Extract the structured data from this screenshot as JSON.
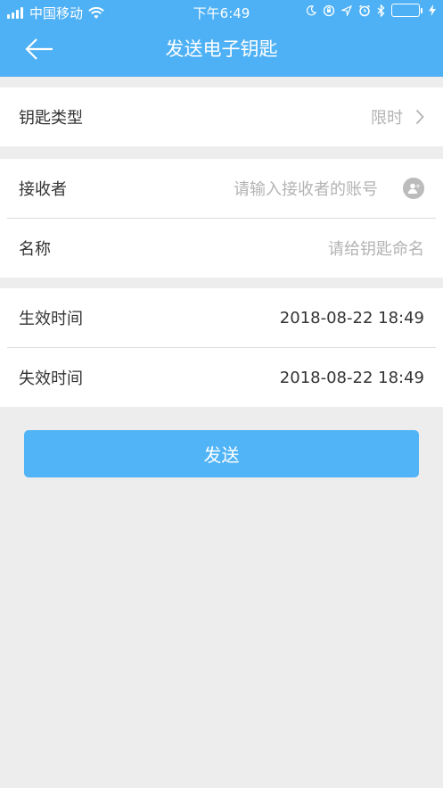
{
  "status_bar": {
    "carrier": "中国移动",
    "time": "下午6:49"
  },
  "nav": {
    "title": "发送电子钥匙"
  },
  "key_type": {
    "label": "钥匙类型",
    "value": "限时"
  },
  "receiver": {
    "label": "接收者",
    "placeholder": "请输入接收者的账号"
  },
  "name": {
    "label": "名称",
    "placeholder": "请给钥匙命名"
  },
  "start_time": {
    "label": "生效时间",
    "value": "2018-08-22 18:49"
  },
  "end_time": {
    "label": "失效时间",
    "value": "2018-08-22 18:49"
  },
  "actions": {
    "send_label": "发送"
  },
  "colors": {
    "header": "#4fb1f5",
    "button": "#51b4f7",
    "background": "#ededed",
    "battery": "#4cd964"
  }
}
